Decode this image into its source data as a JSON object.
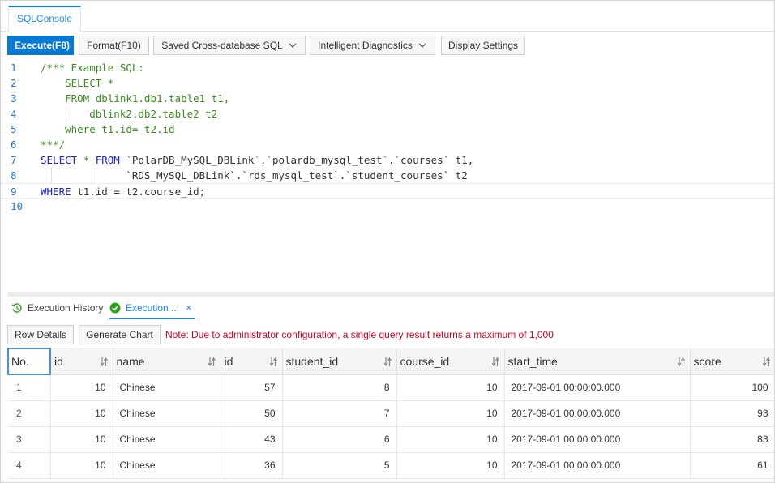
{
  "tab": {
    "label": "SQLConsole"
  },
  "toolbar": {
    "execute": "Execute(F8)",
    "format": "Format(F10)",
    "saved_sql": "Saved Cross-database SQL",
    "diagnostics": "Intelligent Diagnostics",
    "display_settings": "Display Settings"
  },
  "editor": {
    "lines": [
      {
        "n": "1",
        "parts": [
          {
            "t": "/*** Example SQL:",
            "c": "cmt"
          }
        ]
      },
      {
        "n": "2",
        "parts": [
          {
            "t": "    SELECT *",
            "c": "cmt"
          }
        ]
      },
      {
        "n": "3",
        "parts": [
          {
            "t": "    FROM dblink1.db1.table1 t1,",
            "c": "cmt"
          }
        ]
      },
      {
        "n": "4",
        "parts": [
          {
            "t": "        dblink2.db2.table2 t2",
            "c": "cmt"
          }
        ]
      },
      {
        "n": "5",
        "parts": [
          {
            "t": "    where t1.id= t2.id",
            "c": "cmt"
          }
        ]
      },
      {
        "n": "6",
        "parts": [
          {
            "t": "***/",
            "c": "cmt"
          }
        ]
      },
      {
        "n": "7",
        "parts": [
          {
            "t": "SELECT",
            "c": "kw"
          },
          {
            "t": " * ",
            "c": "cmt"
          },
          {
            "t": "FROM",
            "c": "kw"
          },
          {
            "t": " `PolarDB_MySQL_DBLink`.`polardb_mysql_test`.`courses` t1,",
            "c": ""
          }
        ]
      },
      {
        "n": "8",
        "parts": [
          {
            "t": "              `RDS_MySQL_DBLink`.`rds_mysql_test`.`student_courses` t2",
            "c": ""
          }
        ]
      },
      {
        "n": "9",
        "parts": [
          {
            "t": "WHERE",
            "c": "kw"
          },
          {
            "t": " t1.id = t2.course_id;",
            "c": ""
          }
        ]
      },
      {
        "n": "10",
        "parts": [
          {
            "t": "",
            "c": ""
          }
        ]
      }
    ]
  },
  "results": {
    "tabs": [
      {
        "label": "Execution History",
        "icon": "history-icon"
      },
      {
        "label": "Execution ...",
        "icon": "success-check-icon"
      }
    ],
    "row_details": "Row Details",
    "generate_chart": "Generate Chart",
    "note": "Note: Due to administrator configuration, a single query result returns a maximum of 1,000",
    "columns": [
      "No.",
      "id",
      "name",
      "id",
      "student_id",
      "course_id",
      "start_time",
      "score"
    ],
    "rows": [
      [
        "1",
        "10",
        "Chinese",
        "57",
        "8",
        "10",
        "2017-09-01 00:00:00.000",
        "100"
      ],
      [
        "2",
        "10",
        "Chinese",
        "50",
        "7",
        "10",
        "2017-09-01 00:00:00.000",
        "93"
      ],
      [
        "3",
        "10",
        "Chinese",
        "43",
        "6",
        "10",
        "2017-09-01 00:00:00.000",
        "83"
      ],
      [
        "4",
        "10",
        "Chinese",
        "36",
        "5",
        "10",
        "2017-09-01 00:00:00.000",
        "61"
      ]
    ]
  }
}
